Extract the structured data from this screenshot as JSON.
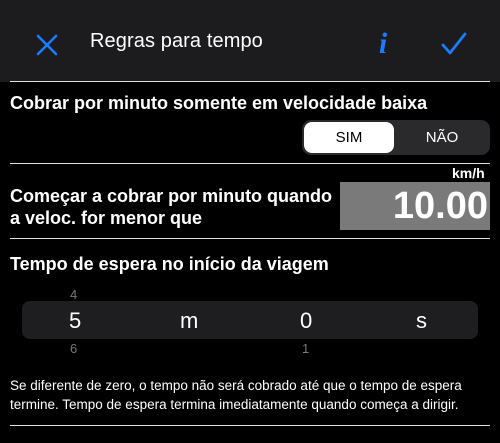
{
  "header": {
    "title": "Regras para tempo",
    "info_label": "i"
  },
  "colors": {
    "accent": "#1a7cff",
    "header_bg": "#1c1c1e",
    "value_bg": "#7a7a7a"
  },
  "slow_speed": {
    "label": "Cobrar por minuto somente em velocidade baixa",
    "options": [
      "SIM",
      "NÃO"
    ],
    "selected": "SIM"
  },
  "threshold": {
    "label_line1": "Começar a cobrar por minuto quando",
    "label_line2": "a veloc. for menor que",
    "unit": "km/h",
    "value": "10.00"
  },
  "wait": {
    "label": "Tempo de espera no início da viagem",
    "picker": {
      "minutes_above": "4",
      "minutes": "5",
      "minutes_below": "6",
      "minutes_unit": "m",
      "seconds": "0",
      "seconds_below": "1",
      "seconds_unit": "s"
    },
    "description_line1": "Se diferente de zero, o tempo não será cobrado até que o tempo de espera",
    "description_line2": "termine. Tempo de espera termina imediatamente quando começa a dirigir."
  }
}
